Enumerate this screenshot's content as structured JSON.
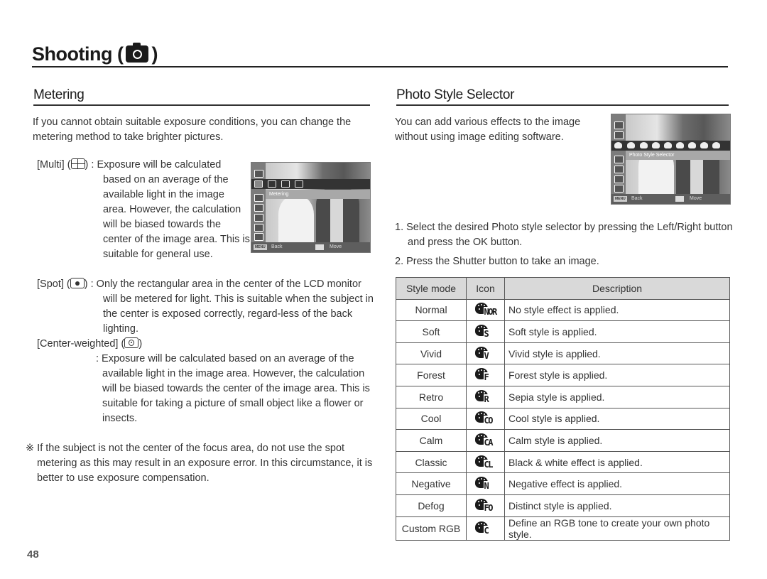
{
  "page": {
    "title": "Shooting (",
    "title_close": ")",
    "title_icon": "camera-icon",
    "number": "48"
  },
  "metering": {
    "title": "Metering",
    "intro": "If you cannot obtain suitable exposure conditions, you can change the metering method to take brighter pictures.",
    "items": [
      {
        "label_prefix": "[Multi] (",
        "label_suffix": ") : ",
        "icon": "multi-metering-icon",
        "text": "Exposure will be calculated based on an average of the available light in the image area. However, the calculation will be biased towards the center of the image area. This is suitable for general use."
      },
      {
        "label_prefix": "[Spot] (",
        "label_suffix": ") : ",
        "icon": "spot-metering-icon",
        "text": "Only the rectangular area in the center of the LCD monitor will be metered for light. This is suitable when the subject in the center is exposed correctly, regard-less of the back lighting."
      },
      {
        "label_prefix": "[Center-weighted] (",
        "label_suffix": ")",
        "icon": "center-weighted-metering-icon",
        "text": ": Exposure will be calculated based on an average of the available light in the image area. However, the calculation will be biased towards the center of the image area. This is suitable for taking a picture of small object like a flower or insects."
      }
    ],
    "note": "※ If the subject is not the center of the focus area, do not use the spot metering as this may result in an exposure error. In this circumstance, it is better to use exposure compensation.",
    "lcd": {
      "label": "Metering",
      "back": "Back",
      "move": "Move",
      "menu": "MENU"
    }
  },
  "photo_style": {
    "title": "Photo Style Selector",
    "intro": "You can add various effects to the image without using image editing software.",
    "lcd": {
      "label": "Photo Style Selector",
      "back": "Back",
      "move": "Move",
      "menu": "MENU"
    },
    "steps": [
      "1. Select the desired Photo style selector by pressing the Left/Right button and press the OK button.",
      "2. Press the Shutter button to take an image."
    ],
    "table": {
      "headers": [
        "Style mode",
        "Icon",
        "Description"
      ],
      "rows": [
        {
          "mode": "Normal",
          "icon_code": "NOR",
          "icon": "style-normal-icon",
          "desc": "No style effect is applied."
        },
        {
          "mode": "Soft",
          "icon_code": "S",
          "icon": "style-soft-icon",
          "desc": "Soft style is applied."
        },
        {
          "mode": "Vivid",
          "icon_code": "V",
          "icon": "style-vivid-icon",
          "desc": "Vivid style is applied."
        },
        {
          "mode": "Forest",
          "icon_code": "F",
          "icon": "style-forest-icon",
          "desc": "Forest style is applied."
        },
        {
          "mode": "Retro",
          "icon_code": "R",
          "icon": "style-retro-icon",
          "desc": "Sepia style is applied."
        },
        {
          "mode": "Cool",
          "icon_code": "CO",
          "icon": "style-cool-icon",
          "desc": "Cool style is applied."
        },
        {
          "mode": "Calm",
          "icon_code": "CA",
          "icon": "style-calm-icon",
          "desc": "Calm style is applied."
        },
        {
          "mode": "Classic",
          "icon_code": "CL",
          "icon": "style-classic-icon",
          "desc": "Black & white effect is applied."
        },
        {
          "mode": "Negative",
          "icon_code": "N",
          "icon": "style-negative-icon",
          "desc": "Negative effect is applied."
        },
        {
          "mode": "Defog",
          "icon_code": "FO",
          "icon": "style-defog-icon",
          "desc": "Distinct style is applied."
        },
        {
          "mode": "Custom RGB",
          "icon_code": "C",
          "icon": "style-custom-rgb-icon",
          "desc": "Define an RGB tone to create your own photo style."
        }
      ]
    }
  }
}
